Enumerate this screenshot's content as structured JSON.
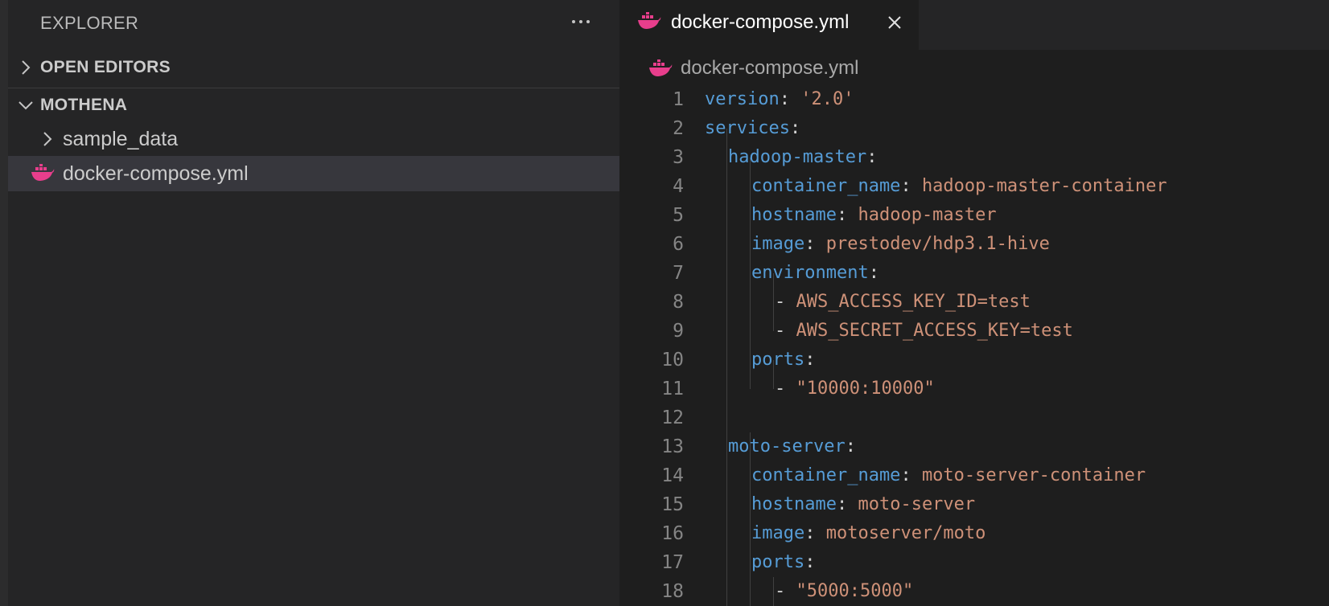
{
  "sidebar": {
    "title": "EXPLORER",
    "more_icon": "ellipsis-icon",
    "open_editors_label": "OPEN EDITORS",
    "workspace_label": "MOTHENA",
    "items": [
      {
        "label": "sample_data",
        "icon": "chevron-right-icon",
        "type": "folder"
      },
      {
        "label": "docker-compose.yml",
        "icon": "docker-icon",
        "type": "file",
        "selected": true
      }
    ]
  },
  "editor": {
    "tab": {
      "label": "docker-compose.yml",
      "icon": "docker-icon",
      "close_icon": "close-icon"
    },
    "breadcrumb": {
      "label": "docker-compose.yml"
    },
    "lines": [
      {
        "num": "1",
        "indent": 0,
        "key": "version",
        "sep": ": ",
        "value": "'2.0'"
      },
      {
        "num": "2",
        "indent": 0,
        "key": "services",
        "sep": ":",
        "value": ""
      },
      {
        "num": "3",
        "indent": 1,
        "key": "hadoop-master",
        "sep": ":",
        "value": ""
      },
      {
        "num": "4",
        "indent": 2,
        "key": "container_name",
        "sep": ": ",
        "value": "hadoop-master-container"
      },
      {
        "num": "5",
        "indent": 2,
        "key": "hostname",
        "sep": ": ",
        "value": "hadoop-master"
      },
      {
        "num": "6",
        "indent": 2,
        "key": "image",
        "sep": ": ",
        "value": "prestodev/hdp3.1-hive"
      },
      {
        "num": "7",
        "indent": 2,
        "key": "environment",
        "sep": ":",
        "value": ""
      },
      {
        "num": "8",
        "indent": 3,
        "key": "",
        "sep": "- ",
        "value": "AWS_ACCESS_KEY_ID=test"
      },
      {
        "num": "9",
        "indent": 3,
        "key": "",
        "sep": "- ",
        "value": "AWS_SECRET_ACCESS_KEY=test"
      },
      {
        "num": "10",
        "indent": 2,
        "key": "ports",
        "sep": ":",
        "value": ""
      },
      {
        "num": "11",
        "indent": 3,
        "key": "",
        "sep": "- ",
        "value": "\"10000:10000\""
      },
      {
        "num": "12",
        "indent": 0,
        "key": "",
        "sep": "",
        "value": ""
      },
      {
        "num": "13",
        "indent": 1,
        "key": "moto-server",
        "sep": ":",
        "value": ""
      },
      {
        "num": "14",
        "indent": 2,
        "key": "container_name",
        "sep": ": ",
        "value": "moto-server-container"
      },
      {
        "num": "15",
        "indent": 2,
        "key": "hostname",
        "sep": ": ",
        "value": "moto-server"
      },
      {
        "num": "16",
        "indent": 2,
        "key": "image",
        "sep": ": ",
        "value": "motoserver/moto"
      },
      {
        "num": "17",
        "indent": 2,
        "key": "ports",
        "sep": ":",
        "value": ""
      },
      {
        "num": "18",
        "indent": 3,
        "key": "",
        "sep": "- ",
        "value": "\"5000:5000\""
      }
    ]
  },
  "colors": {
    "key": "#569cd6",
    "string": "#ce9178",
    "line_number": "#858585",
    "docker_icon": "#e83e8c",
    "selected_row": "#37373d"
  }
}
